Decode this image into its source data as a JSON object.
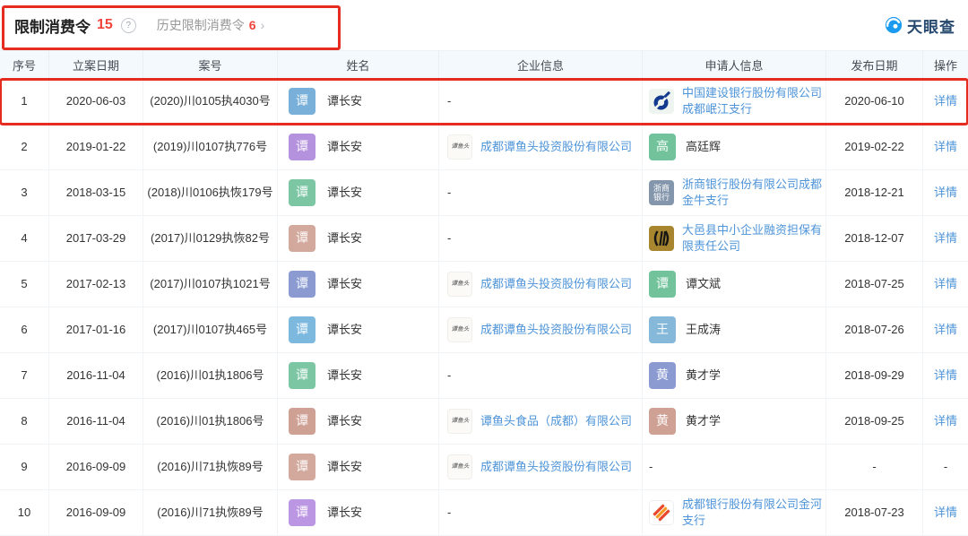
{
  "header": {
    "title": "限制消费令",
    "count": "15",
    "help_icon": "?",
    "history_label": "历史限制消费令",
    "history_count": "6",
    "chevron": "›",
    "brand": "天眼查"
  },
  "colors": {
    "accent_red": "#f0443b",
    "annotation_red": "#e62c21",
    "link_blue": "#4e94d9"
  },
  "logo_text": {
    "tanyutou": "谭鱼头",
    "zheshang": "浙商银行"
  },
  "table": {
    "headers": [
      "序号",
      "立案日期",
      "案号",
      "姓名",
      "企业信息",
      "申请人信息",
      "发布日期",
      "操作"
    ],
    "detail_label": "详情",
    "rows": [
      {
        "seq": "1",
        "filing_date": "2020-06-03",
        "case_no": "(2020)川0105执4030号",
        "person": {
          "initial": "谭",
          "name": "谭长安",
          "color": "#79b0d9"
        },
        "company": {
          "kind": "dash"
        },
        "applicant": {
          "kind": "company",
          "logo": "ccb",
          "name": "中国建设银行股份有限公司成都岷江支行"
        },
        "publish_date": "2020-06-10",
        "action": "详情",
        "highlighted": true
      },
      {
        "seq": "2",
        "filing_date": "2019-01-22",
        "case_no": "(2019)川0107执776号",
        "person": {
          "initial": "谭",
          "name": "谭长安",
          "color": "#b592dd"
        },
        "company": {
          "kind": "link",
          "logo": "tanyutou",
          "name": "成都谭鱼头投资股份有限公司"
        },
        "applicant": {
          "kind": "person",
          "initial": "高",
          "name": "高廷辉",
          "color": "#72c39c"
        },
        "publish_date": "2019-02-22",
        "action": "详情",
        "highlighted": false
      },
      {
        "seq": "3",
        "filing_date": "2018-03-15",
        "case_no": "(2018)川0106执恢179号",
        "person": {
          "initial": "谭",
          "name": "谭长安",
          "color": "#7cc6a4"
        },
        "company": {
          "kind": "dash"
        },
        "applicant": {
          "kind": "company",
          "logo": "zheshang",
          "name": "浙商银行股份有限公司成都金牛支行"
        },
        "publish_date": "2018-12-21",
        "action": "详情",
        "highlighted": false
      },
      {
        "seq": "4",
        "filing_date": "2017-03-29",
        "case_no": "(2017)川0129执恢82号",
        "person": {
          "initial": "谭",
          "name": "谭长安",
          "color": "#d2a99c"
        },
        "company": {
          "kind": "dash"
        },
        "applicant": {
          "kind": "company",
          "logo": "dayi",
          "name": "大邑县中小企业融资担保有限责任公司"
        },
        "publish_date": "2018-12-07",
        "action": "详情",
        "highlighted": false
      },
      {
        "seq": "5",
        "filing_date": "2017-02-13",
        "case_no": "(2017)川0107执1021号",
        "person": {
          "initial": "谭",
          "name": "谭长安",
          "color": "#8b9bd2"
        },
        "company": {
          "kind": "link",
          "logo": "tanyutou",
          "name": "成都谭鱼头投资股份有限公司"
        },
        "applicant": {
          "kind": "person",
          "initial": "谭",
          "name": "谭文斌",
          "color": "#72c39c"
        },
        "publish_date": "2018-07-25",
        "action": "详情",
        "highlighted": false
      },
      {
        "seq": "6",
        "filing_date": "2017-01-16",
        "case_no": "(2017)川0107执465号",
        "person": {
          "initial": "谭",
          "name": "谭长安",
          "color": "#7db9de"
        },
        "company": {
          "kind": "link",
          "logo": "tanyutou",
          "name": "成都谭鱼头投资股份有限公司"
        },
        "applicant": {
          "kind": "person",
          "initial": "王",
          "name": "王成涛",
          "color": "#85b8d9"
        },
        "publish_date": "2018-07-26",
        "action": "详情",
        "highlighted": false
      },
      {
        "seq": "7",
        "filing_date": "2016-11-04",
        "case_no": "(2016)川01执1806号",
        "person": {
          "initial": "谭",
          "name": "谭长安",
          "color": "#7cc6a4"
        },
        "company": {
          "kind": "dash"
        },
        "applicant": {
          "kind": "person",
          "initial": "黄",
          "name": "黄才学",
          "color": "#8b9bd2"
        },
        "publish_date": "2018-09-29",
        "action": "详情",
        "highlighted": false
      },
      {
        "seq": "8",
        "filing_date": "2016-11-04",
        "case_no": "(2016)川01执1806号",
        "person": {
          "initial": "谭",
          "name": "谭长安",
          "color": "#cfa195"
        },
        "company": {
          "kind": "link",
          "logo": "tanyutou",
          "name": "谭鱼头食品（成都）有限公司"
        },
        "applicant": {
          "kind": "person",
          "initial": "黄",
          "name": "黄才学",
          "color": "#cfa195"
        },
        "publish_date": "2018-09-25",
        "action": "详情",
        "highlighted": false
      },
      {
        "seq": "9",
        "filing_date": "2016-09-09",
        "case_no": "(2016)川71执恢89号",
        "person": {
          "initial": "谭",
          "name": "谭长安",
          "color": "#d2a99c"
        },
        "company": {
          "kind": "link",
          "logo": "tanyutou",
          "name": "成都谭鱼头投资股份有限公司"
        },
        "applicant": {
          "kind": "dash"
        },
        "publish_date": "-",
        "action": "-",
        "highlighted": false
      },
      {
        "seq": "10",
        "filing_date": "2016-09-09",
        "case_no": "(2016)川71执恢89号",
        "person": {
          "initial": "谭",
          "name": "谭长安",
          "color": "#bb96e2"
        },
        "company": {
          "kind": "dash"
        },
        "applicant": {
          "kind": "company",
          "logo": "cdbank",
          "name": "成都银行股份有限公司金河支行"
        },
        "publish_date": "2018-07-23",
        "action": "详情",
        "highlighted": false
      }
    ]
  }
}
